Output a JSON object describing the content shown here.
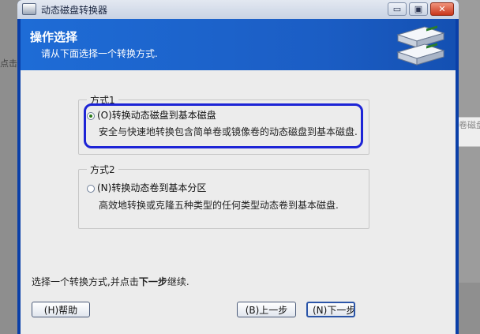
{
  "background": {
    "left_text": "点击",
    "right_text": "卷磁盘"
  },
  "window": {
    "title": "动态磁盘转换器",
    "controls": {
      "minimize": "▭",
      "maximize": "▣",
      "close": "✕"
    }
  },
  "header": {
    "title": "操作选择",
    "subtitle": "请从下面选择一个转换方式."
  },
  "options": [
    {
      "legend": "方式1",
      "label": "(O)转换动态磁盘到基本磁盘",
      "description": "安全与快速地转换包含简单卷或镜像卷的动态磁盘到基本磁盘.",
      "selected": true
    },
    {
      "legend": "方式2",
      "label": "(N)转换动态卷到基本分区",
      "description": "高效地转换或克隆五种类型的任何类型动态卷到基本磁盘.",
      "selected": false
    }
  ],
  "footer": {
    "hint_prefix": "选择一个转换方式,并点击",
    "hint_bold": "下一步",
    "hint_suffix": "继续.",
    "help_label": "(H)帮助",
    "back_label": "(B)上一步",
    "next_label": "(N)下一步"
  },
  "colors": {
    "window_frame": "#0a3fa8",
    "header_blue": "#1e6cd6",
    "focus_ring": "#1d24d6",
    "content_bg": "#ececec",
    "close_red": "#c9361c"
  }
}
